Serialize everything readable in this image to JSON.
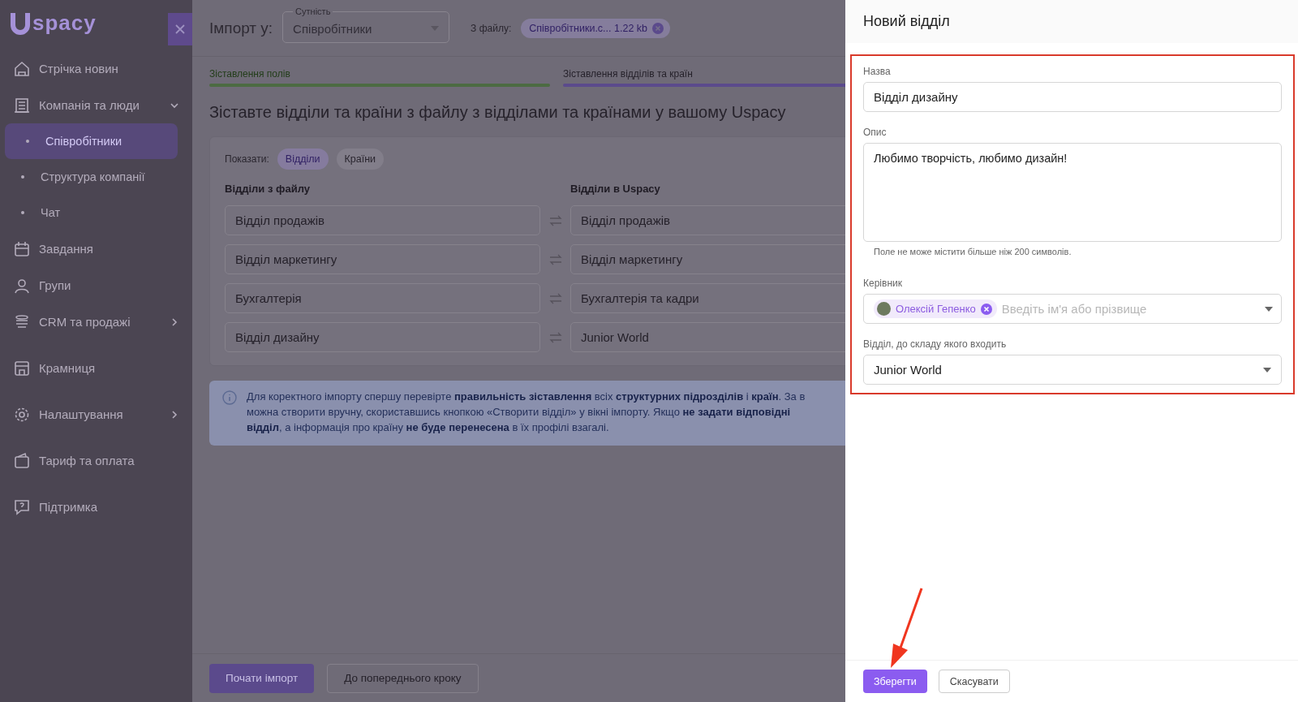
{
  "sidebar": {
    "logo": "spacy",
    "items": [
      {
        "label": "Стрічка новин",
        "selected": false
      },
      {
        "label": "Компанія та люди",
        "expanded": true,
        "selected": false,
        "children": [
          {
            "label": "Співробітники",
            "selected": true
          },
          {
            "label": "Структура компанії",
            "selected": false
          },
          {
            "label": "Чат",
            "selected": false
          }
        ]
      },
      {
        "label": "Завдання",
        "selected": false
      },
      {
        "label": "Групи",
        "selected": false
      },
      {
        "label": "CRM та продажі",
        "expanded": false,
        "selected": false
      },
      {
        "label": "Крамниця",
        "selected": false
      },
      {
        "label": "Налаштування",
        "expanded": false,
        "selected": false
      },
      {
        "label": "Тариф та оплата",
        "selected": false
      },
      {
        "label": "Підтримка",
        "selected": false
      }
    ]
  },
  "header": {
    "title": "Імпорт у:",
    "entity": {
      "label": "Сутність",
      "value": "Співробітники"
    },
    "file_label": "З файлу:",
    "file": "Співробітники.c... 1.22 kb"
  },
  "steps": [
    {
      "label": "Зіставлення полів",
      "done": true
    },
    {
      "label": "Зіставлення відділів та країн",
      "done": false
    }
  ],
  "heading": "Зіставте відділи та країни з файлу з відділами та країнами у вашому Uspacy",
  "filter": {
    "label": "Показати:",
    "options": [
      {
        "label": "Відділи",
        "selected": true
      },
      {
        "label": "Країни",
        "selected": false
      }
    ]
  },
  "mapping": {
    "columns": [
      "Відділи з файлу",
      "Відділи в Uspacy"
    ],
    "rows": [
      [
        "Відділ продажів",
        "Відділ продажів"
      ],
      [
        "Відділ маркетингу",
        "Відділ маркетингу"
      ],
      [
        "Бухгалтерія",
        "Бухгалтерія та кадри"
      ],
      [
        "Відділ дизайну",
        "Junior World"
      ]
    ]
  },
  "note": [
    "Для коректного імпорту спершу перевірте **правильність зіставлення** всіх **структурних підрозділів** і **країн**. За в",
    "можна створити вручну, скориставшись кнопкою «Створити відділ» у вікні імпорту. Якщо **не задати відповідні**",
    "**відділ**, а інформація про країну **не буде перенесена** в їх профілі взагалі."
  ],
  "footer": {
    "buttons": [
      {
        "label": "Почати імпорт",
        "primary": true
      },
      {
        "label": "До попереднього кроку",
        "primary": false
      }
    ]
  },
  "panel": {
    "title": "Новий відділ",
    "name": {
      "label": "Назва",
      "value": "Відділ дизайну"
    },
    "description": {
      "label": "Опис",
      "value": "Любимо творчість, любимо дизайн!",
      "hint": "Поле не може містити більше ніж 200 символів."
    },
    "manager": {
      "label": "Керівник",
      "chip": "Олексій Гепенко",
      "placeholder": "Введіть ім'я або прізвище"
    },
    "parent": {
      "label": "Відділ, до складу якого входить",
      "value": "Junior World"
    },
    "buttons": [
      {
        "label": "Зберегти",
        "primary": true
      },
      {
        "label": "Скасувати",
        "primary": false
      }
    ]
  }
}
